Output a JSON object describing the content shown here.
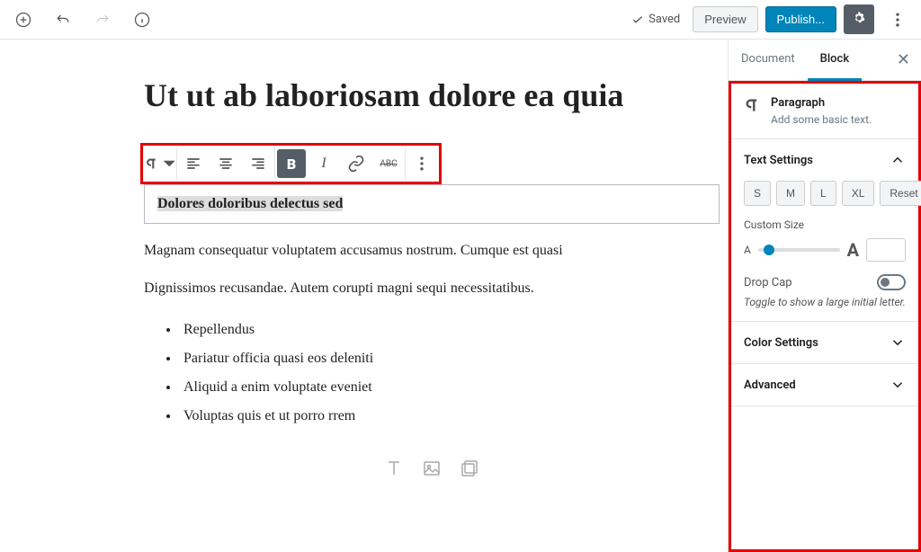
{
  "topbar": {
    "saved_label": "Saved",
    "preview_label": "Preview",
    "publish_label": "Publish..."
  },
  "editor": {
    "title": "Ut ut ab laboriosam dolore ea quia",
    "selected_block_text": "Dolores doloribus delectus sed",
    "paragraphs": [
      "Magnam consequatur voluptatem accusamus nostrum. Cumque est quasi",
      "Dignissimos recusandae. Autem corupti magni sequi necessitatibus."
    ],
    "list_items": [
      "Repellendus",
      "Pariatur officia quasi eos deleniti",
      "Aliquid a enim voluptate eveniet",
      "Voluptas quis et ut porro rrem"
    ]
  },
  "sidebar": {
    "tabs": {
      "document": "Document",
      "block": "Block"
    },
    "block_header": {
      "title": "Paragraph",
      "description": "Add some basic text."
    },
    "text_settings": {
      "title": "Text Settings",
      "sizes": [
        "S",
        "M",
        "L",
        "XL"
      ],
      "reset": "Reset",
      "custom_size_label": "Custom Size",
      "small_a": "A",
      "big_a": "A",
      "dropcap_label": "Drop Cap",
      "dropcap_hint": "Toggle to show a large initial letter."
    },
    "color_settings_title": "Color Settings",
    "advanced_title": "Advanced"
  }
}
